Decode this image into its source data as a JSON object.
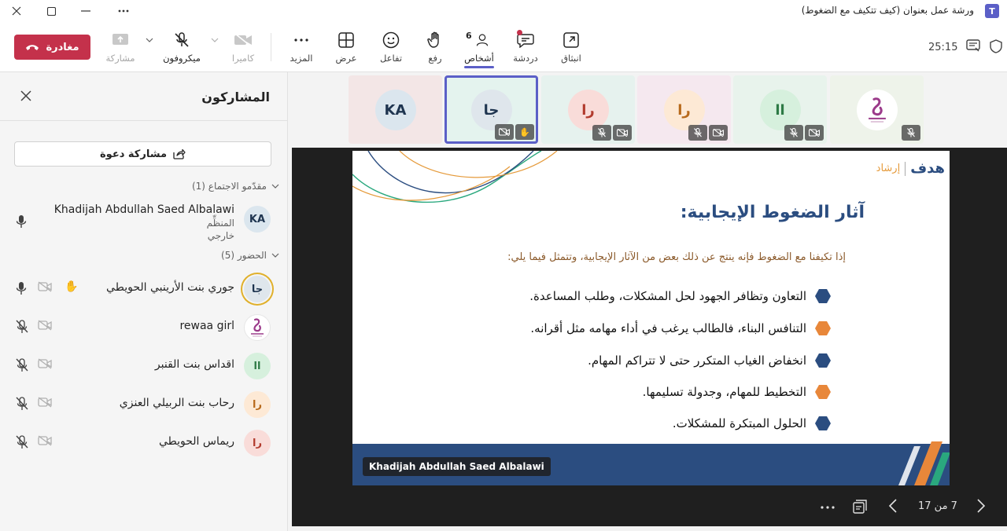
{
  "window": {
    "title": "ورشة عمل بعنوان (كيف تتكيف مع الضغوط)",
    "app_icon": "T"
  },
  "toolbar": {
    "leave_label": "مغادرة",
    "items": {
      "share": "مشاركة",
      "mic": "ميكروفون",
      "camera": "كاميرا",
      "more": "المزيد",
      "view": "عرض",
      "react": "تفاعل",
      "raise": "رفع",
      "people": "أشخاص",
      "chat": "دردشة",
      "popout": "انبثاق"
    },
    "people_count": "6",
    "timer": "25:15",
    "colors": {
      "leave": "#c4314b",
      "accent": "#5b5fc7"
    }
  },
  "sidebar": {
    "title": "المشاركون",
    "invite_label": "مشاركة دعوة",
    "presenters_header": "مقدّمو الاجتماع (1)",
    "attendees_header": "الحضور (5)",
    "presenter": {
      "name": "Khadijah Abdullah Saed Albalawi",
      "initials": "KA",
      "role": "المنظِّم",
      "type": "خارجي"
    },
    "attendees": [
      {
        "name": "جوري بنت الأرينبي الحويطي",
        "initials": "جا",
        "hand": "✋",
        "bg": "#dfe6ec",
        "fg": "#1f3550"
      },
      {
        "name": "rewaa girl",
        "initials": "",
        "bg": "#ffffff",
        "fg": "#9b3a8a"
      },
      {
        "name": "اقداس بنت القنبر",
        "initials": "اا",
        "bg": "#d6f0dd",
        "fg": "#2d7a45"
      },
      {
        "name": "رحاب بنت الربيلي العنزي",
        "initials": "را",
        "bg": "#fde9d5",
        "fg": "#b86a1c"
      },
      {
        "name": "ريماس الحويطي",
        "initials": "را",
        "bg": "#f9dcd9",
        "fg": "#b23b2e"
      }
    ]
  },
  "video_strip": {
    "tiles": [
      {
        "initials": "KA",
        "bg": "#f3e6e6",
        "avatar_bg": "#dbe6ee",
        "avatar_fg": "#1f3550"
      },
      {
        "initials": "جا",
        "bg": "#e4f3ee",
        "avatar_bg": "#dfe6ec",
        "avatar_fg": "#1f3550",
        "hand": "✋"
      },
      {
        "initials": "را",
        "bg": "#e6f2ee",
        "avatar_bg": "#f9dcd9",
        "avatar_fg": "#b23b2e"
      },
      {
        "initials": "را",
        "bg": "#f5e8ef",
        "avatar_bg": "#fde9d5",
        "avatar_fg": "#b86a1c"
      },
      {
        "initials": "اا",
        "bg": "#e8f3ec",
        "avatar_bg": "#d6f0dd",
        "avatar_fg": "#2d7a45"
      },
      {
        "initials": "",
        "bg": "#eef3ea",
        "avatar_bg": "#ffffff",
        "avatar_fg": "#9b3a8a"
      }
    ]
  },
  "slide": {
    "logo_main": "هدف",
    "logo_side": "إرشاد",
    "title": "آثار الضغوط الإيجابية:",
    "intro": "إذا تكيفنا مع الضغوط فإنه ينتج عن ذلك بعض من الآثار الإيجابية، وتتمثل فيما يلي:",
    "bullets": [
      {
        "text": "التعاون وتظافر الجهود لحل المشكلات، وطلب المساعدة.",
        "color": "#2b4d80"
      },
      {
        "text": "التنافس البناء، فالطالب يرغب في أداء مهامه مثل أقرانه.",
        "color": "#e8873a"
      },
      {
        "text": "انخفاض الغياب المتكرر حتى لا تتراكم المهام.",
        "color": "#2b4d80"
      },
      {
        "text": "التخطيط للمهام، وجدولة تسليمها.",
        "color": "#e8873a"
      },
      {
        "text": "الحلول المبتكرة للمشكلات.",
        "color": "#2b4d80"
      }
    ],
    "presenter_tag": "Khadijah Abdullah Saed Albalawi"
  },
  "stage": {
    "page_indicator": "7 من 17"
  }
}
